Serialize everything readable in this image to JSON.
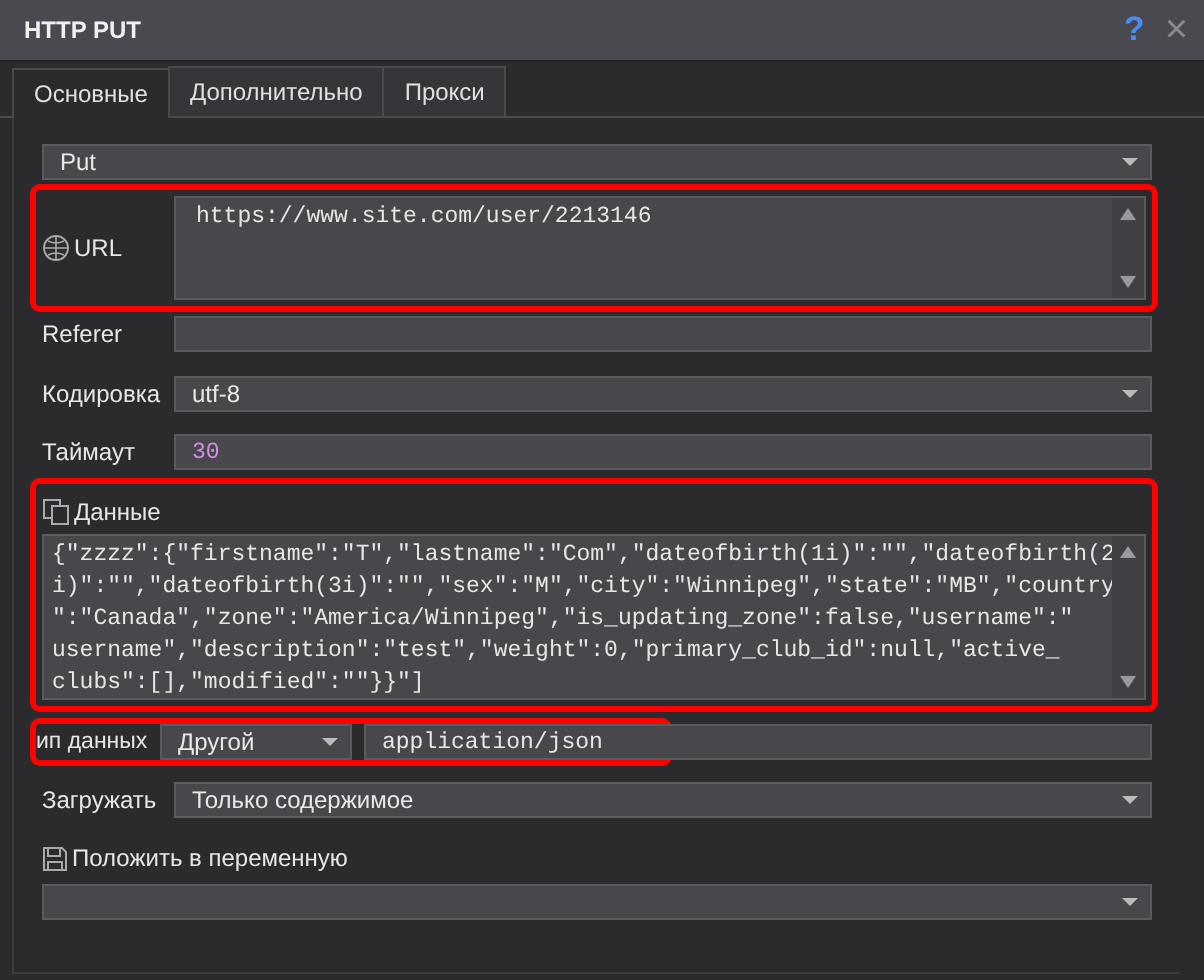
{
  "window": {
    "title": "HTTP PUT",
    "help": "?",
    "close": "×"
  },
  "tabs": [
    {
      "label": "Основные",
      "selected": true
    },
    {
      "label": "Дополнительно",
      "selected": false
    },
    {
      "label": "Прокси",
      "selected": false
    }
  ],
  "method": {
    "value": "Put"
  },
  "url": {
    "label": "URL",
    "value": "https://www.site.com/user/2213146",
    "highlighted": true
  },
  "referer": {
    "label": "Referer"
  },
  "encoding": {
    "label": "Кодировка",
    "value": "utf-8"
  },
  "timeout": {
    "label": "Таймаут",
    "value": "30"
  },
  "data": {
    "label": "Данные",
    "highlighted": true,
    "lines": [
      "{\"zzzz\":{\"firstname\":\"T\",\"lastname\":\"Com\",\"dateofbirth(1i)\":\"\",\"dateofbirth(2",
      "i)\":\"\",\"dateofbirth(3i)\":\"\",\"sex\":\"M\",\"city\":\"Winnipeg\",\"state\":\"MB\",\"country",
      "\":\"Canada\",\"zone\":\"America/Winnipeg\",\"is_updating_zone\":false,\"username\":\"",
      "username\",\"description\":\"test\",\"weight\":0,\"primary_club_id\":null,\"active_",
      "clubs\":[],\"modified\":\"\"}}\"]"
    ]
  },
  "content_type": {
    "label": "ип данных",
    "type": "Другой",
    "value": "application/json",
    "highlighted": true
  },
  "load": {
    "label": "Загружать",
    "value": "Только содержимое"
  },
  "save_to_variable": {
    "label": "Положить в переменную"
  }
}
